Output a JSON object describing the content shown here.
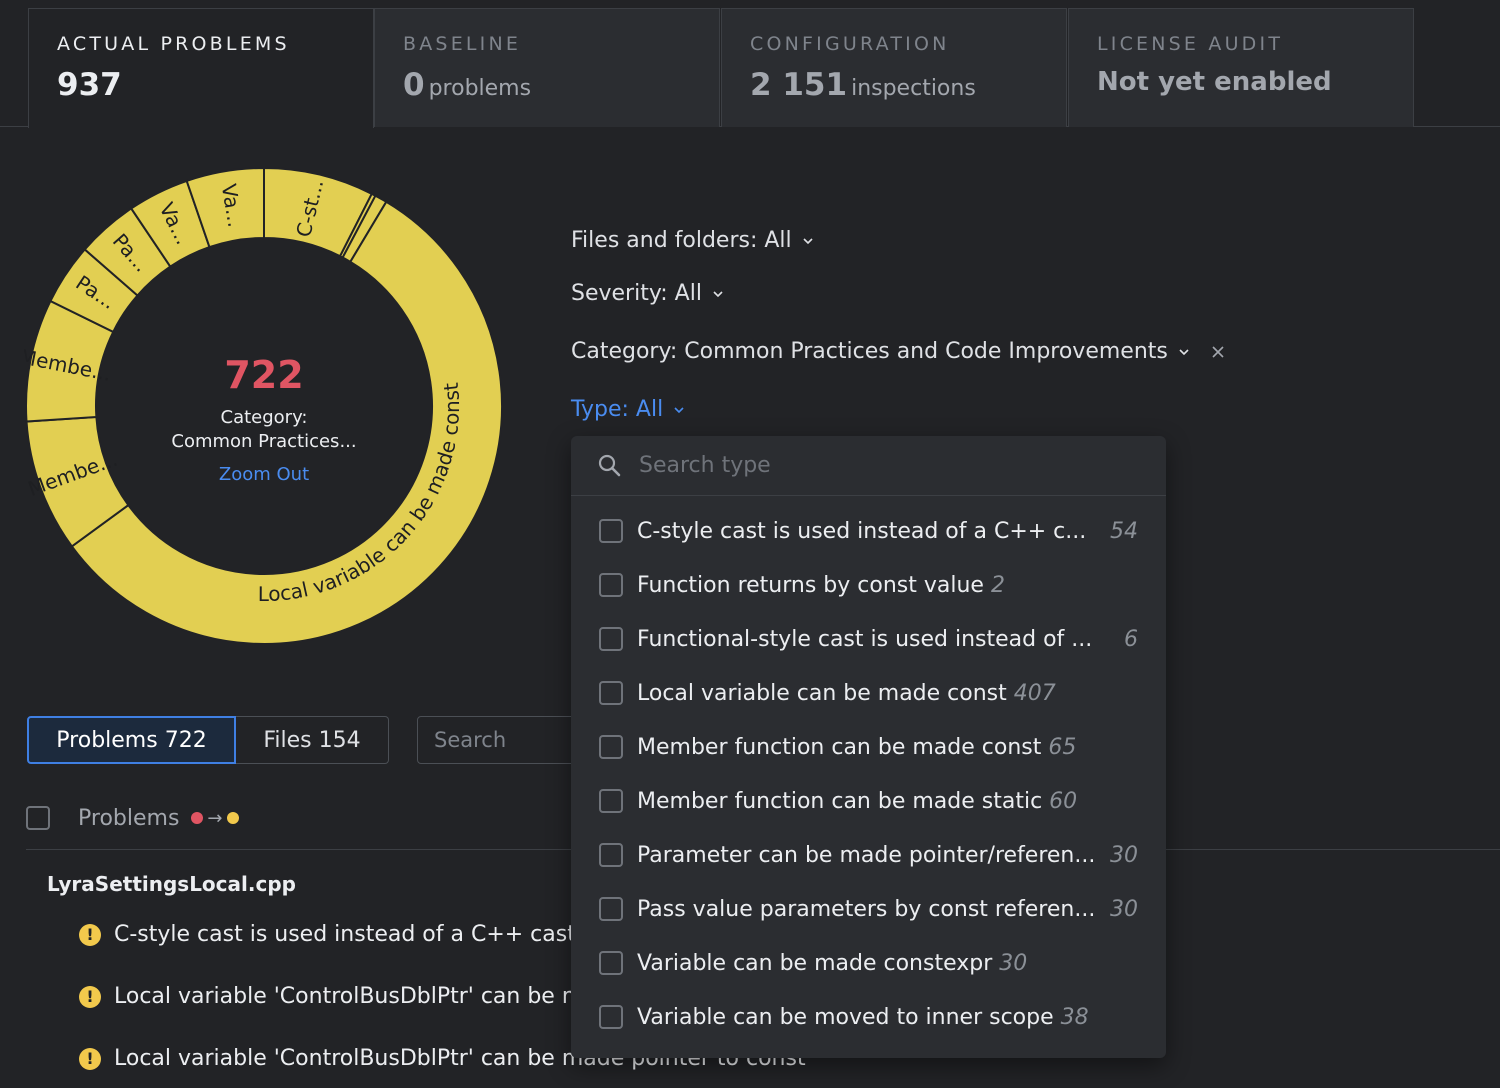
{
  "tabs": [
    {
      "title": "ACTUAL PROBLEMS",
      "value": "937",
      "unit": ""
    },
    {
      "title": "BASELINE",
      "value": "0",
      "unit": "problems"
    },
    {
      "title": "CONFIGURATION",
      "value": "2 151",
      "unit": "inspections"
    },
    {
      "title": "LICENSE AUDIT",
      "value": "Not yet enabled",
      "unit": ""
    }
  ],
  "donut": {
    "count": "722",
    "category_line1": "Category:",
    "category_line2": "Common Practices...",
    "zoom_out": "Zoom Out",
    "color": "#e2cf52",
    "segments": [
      {
        "label": "C-st...",
        "value": 54
      },
      {
        "label": "",
        "value": 2
      },
      {
        "label": "",
        "value": 6
      },
      {
        "label": "Local variable can be made const",
        "value": 407
      },
      {
        "label": "Membe...",
        "value": 65
      },
      {
        "label": "Membe...",
        "value": 60
      },
      {
        "label": "Pa...",
        "value": 30
      },
      {
        "label": "Pa...",
        "value": 30
      },
      {
        "label": "Va...",
        "value": 30
      },
      {
        "label": "Va...",
        "value": 38
      }
    ]
  },
  "filters": {
    "files": "Files and folders: All",
    "severity": "Severity: All",
    "category": "Category: Common Practices and Code Improvements",
    "type": "Type: All"
  },
  "type_dropdown": {
    "placeholder": "Search type",
    "options": [
      {
        "label": "C-style cast is used instead of a C++ c...",
        "count": "54",
        "right": true
      },
      {
        "label": "Function returns by const value",
        "count": "2",
        "right": false
      },
      {
        "label": "Functional-style cast is used instead of ...",
        "count": "6",
        "right": true
      },
      {
        "label": "Local variable can be made const",
        "count": "407",
        "right": false
      },
      {
        "label": "Member function can be made const",
        "count": "65",
        "right": false
      },
      {
        "label": "Member function can be made static",
        "count": "60",
        "right": false
      },
      {
        "label": "Parameter can be made pointer/referen...",
        "count": "30",
        "right": true
      },
      {
        "label": "Pass value parameters by const referen...",
        "count": "30",
        "right": true
      },
      {
        "label": "Variable can be made constexpr",
        "count": "30",
        "right": false
      },
      {
        "label": "Variable can be moved to inner scope",
        "count": "38",
        "right": false
      }
    ]
  },
  "bottom": {
    "problems_tab": "Problems 722",
    "files_tab": "Files 154",
    "search_placeholder": "Search",
    "problems_header": "Problems",
    "severity_from": "#e05563",
    "severity_to": "#f2c94c",
    "file_name": "LyraSettingsLocal.cpp",
    "issues": [
      "C-style cast is used instead of a C++ cast",
      "Local variable 'ControlBusDblPtr' can be made const",
      "Local variable 'ControlBusDblPtr' can be made pointer to const"
    ]
  }
}
